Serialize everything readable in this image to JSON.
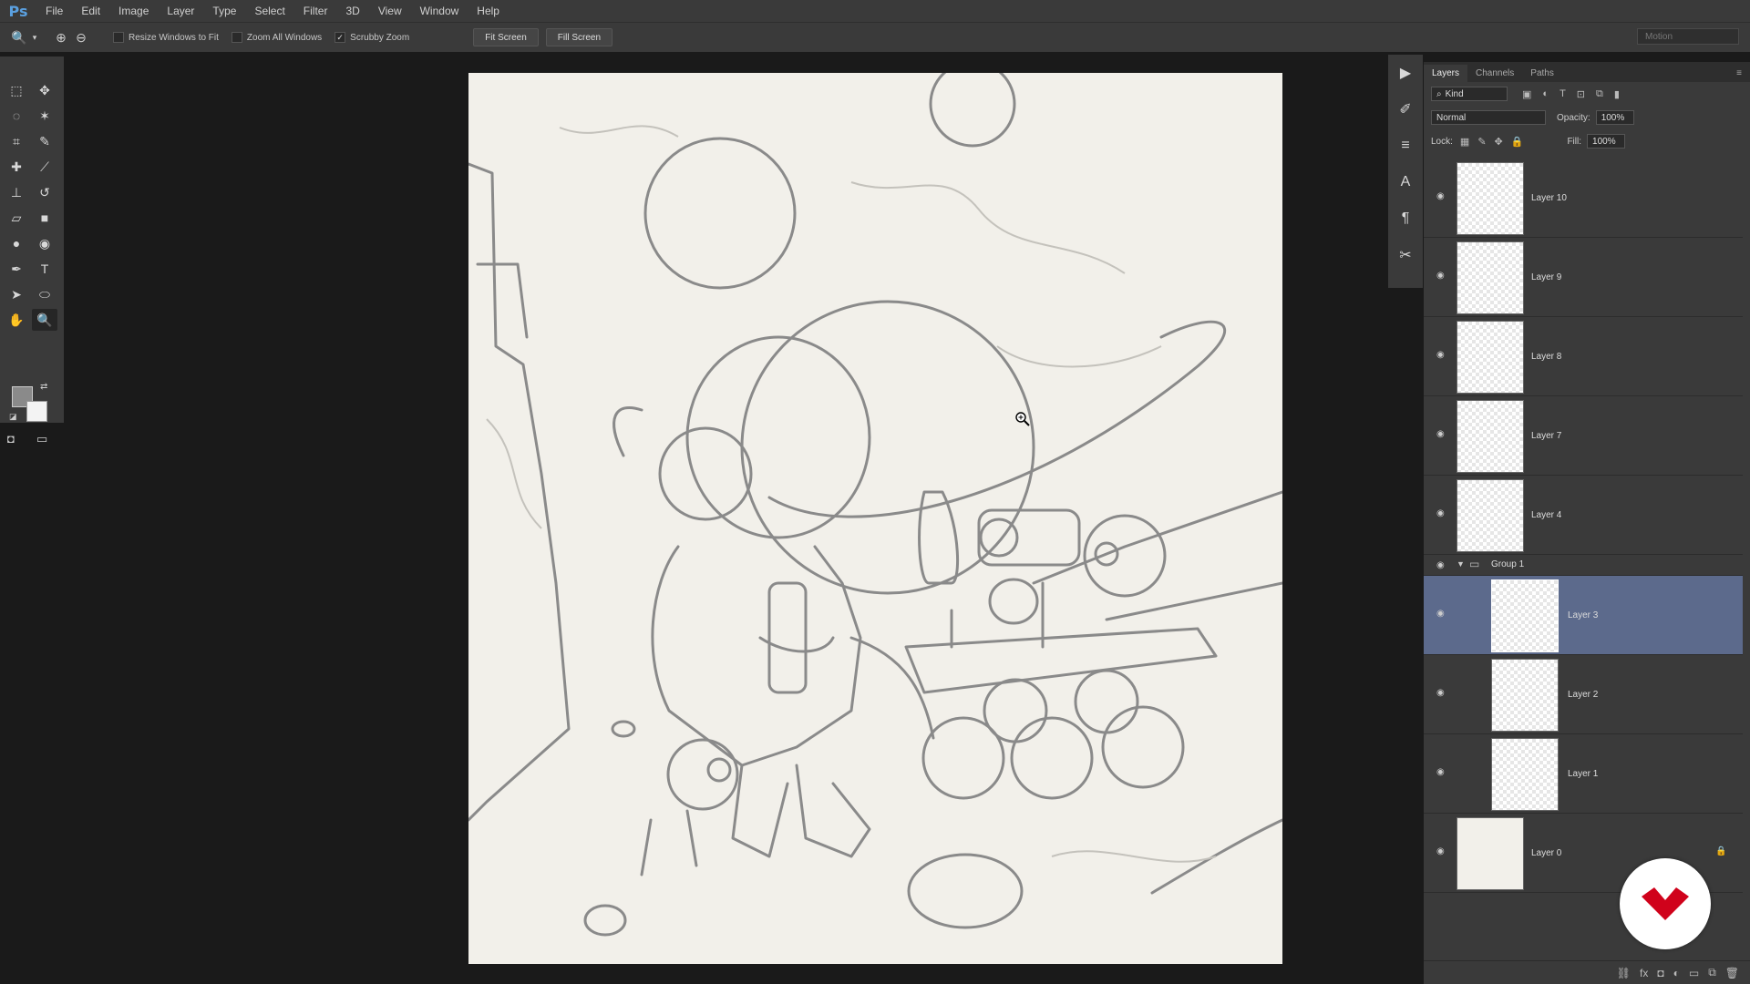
{
  "app": {
    "logo": "Ps"
  },
  "menu": [
    "File",
    "Edit",
    "Image",
    "Layer",
    "Type",
    "Select",
    "Filter",
    "3D",
    "View",
    "Window",
    "Help"
  ],
  "options": {
    "resize_windows": "Resize Windows to Fit",
    "zoom_all": "Zoom All Windows",
    "scrubby_zoom": "Scrubby Zoom",
    "scrubby_check": "✓",
    "fit_screen": "Fit Screen",
    "fill_screen": "Fill Screen",
    "workspace": "Motion"
  },
  "panel": {
    "tabs": [
      "Layers",
      "Channels",
      "Paths"
    ],
    "kind": "Kind",
    "blend_mode": "Normal",
    "opacity_label": "Opacity:",
    "opacity": "100%",
    "lock_label": "Lock:",
    "fill_label": "Fill:",
    "fill": "100%"
  },
  "layers": [
    {
      "name": "Layer 10"
    },
    {
      "name": "Layer 9"
    },
    {
      "name": "Layer 8"
    },
    {
      "name": "Layer 7"
    },
    {
      "name": "Layer 4"
    },
    {
      "name": "Group 1"
    },
    {
      "name": "Layer 3"
    },
    {
      "name": "Layer 2"
    },
    {
      "name": "Layer 1"
    },
    {
      "name": "Layer 0"
    }
  ],
  "colors": {
    "selected_layer": "#5c6a8c",
    "canvas": "#f2f0ea",
    "watermark": "#d0021b"
  }
}
